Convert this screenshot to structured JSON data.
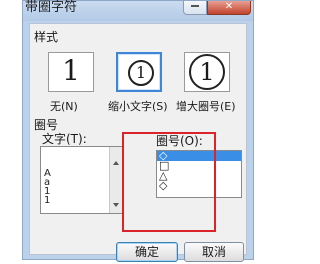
{
  "dialog": {
    "title": "带圈字符",
    "close_glyph": "✕"
  },
  "style_section": {
    "label": "样式",
    "options": [
      {
        "glyph": "1",
        "label": "无(N)"
      },
      {
        "glyph": "1",
        "label": "缩小文字(S)"
      },
      {
        "glyph": "1",
        "label": "增大圈号(E)"
      }
    ],
    "selected_index": 1
  },
  "encircle_section": {
    "label": "圈号",
    "text_label": "文字(T):",
    "text_items": [
      "A",
      "a",
      "1",
      "1"
    ],
    "symbol_label": "圈号(O):",
    "symbol_items": [
      "◇",
      "□",
      "△",
      "◇"
    ],
    "selected_symbol_index": 0
  },
  "buttons": {
    "ok": "确定",
    "cancel": "取消"
  },
  "colors": {
    "highlight": "#d9252a",
    "selection": "#3a8ee6",
    "accent_border": "#3f86d9"
  }
}
